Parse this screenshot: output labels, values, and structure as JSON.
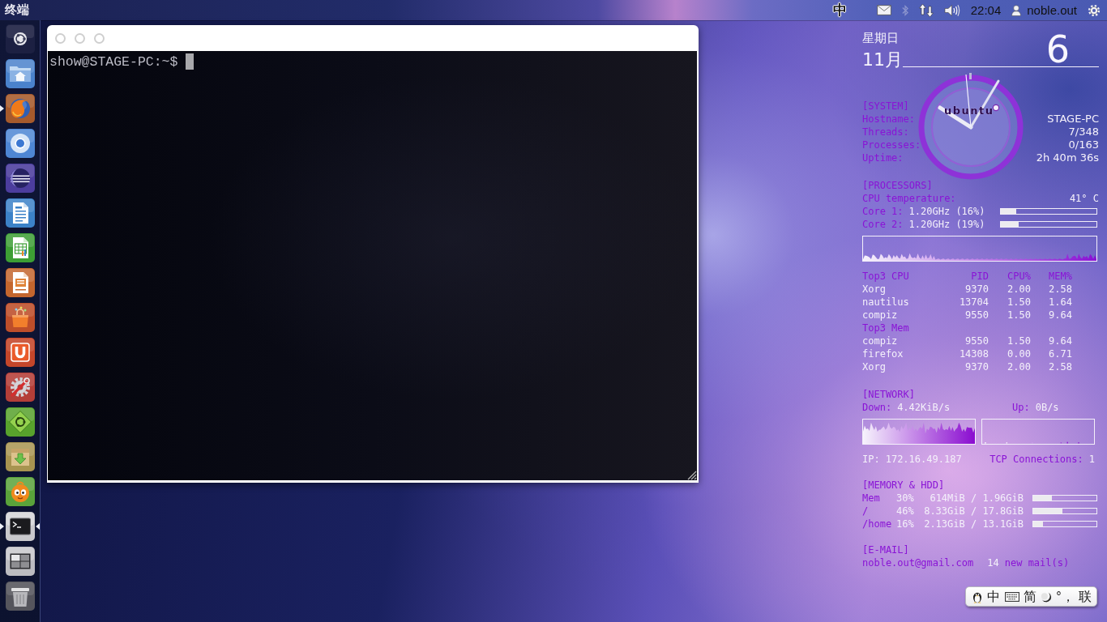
{
  "top_panel": {
    "app_title": "终端",
    "input_method": "中",
    "bluetooth_enabled": false,
    "clock": "22:04",
    "user": "noble.out"
  },
  "launcher": [
    {
      "running": false,
      "focused": false
    },
    {
      "running": false,
      "focused": false
    },
    {
      "running": true,
      "focused": false
    },
    {
      "running": false,
      "focused": false
    },
    {
      "running": false,
      "focused": false
    },
    {
      "running": false,
      "focused": false
    },
    {
      "running": false,
      "focused": false
    },
    {
      "running": false,
      "focused": false
    },
    {
      "running": false,
      "focused": false
    },
    {
      "running": false,
      "focused": false
    },
    {
      "running": false,
      "focused": false
    },
    {
      "running": false,
      "focused": false
    },
    {
      "running": false,
      "focused": false
    },
    {
      "running": false,
      "focused": false
    },
    {
      "running": true,
      "focused": true
    },
    {
      "running": false,
      "focused": false
    },
    {
      "running": false,
      "focused": false
    }
  ],
  "terminal": {
    "prompt": "show@STAGE-PC:~$"
  },
  "conky": {
    "weekday": "星期日",
    "month": "11月",
    "day": "6",
    "clock_logo": "ubuntu",
    "system": {
      "heading": "[SYSTEM]",
      "rows": [
        {
          "label": "Hostname:",
          "value": "STAGE-PC"
        },
        {
          "label": "Threads:",
          "value": "7/348"
        },
        {
          "label": "Processes:",
          "value": "0/163"
        },
        {
          "label": "Uptime:",
          "value": "2h 40m 36s"
        }
      ]
    },
    "processors": {
      "heading": "[PROCESSORS]",
      "temperature": {
        "label": "CPU temperature:",
        "value": "41° C"
      },
      "cores": [
        {
          "label": "Core 1:",
          "value": "1.20GHz (16%)",
          "level": 0.16
        },
        {
          "label": "Core 2:",
          "value": "1.20GHz (19%)",
          "level": 0.19
        }
      ]
    },
    "top_processes": {
      "columns": [
        "Top3 CPU",
        "PID",
        "CPU%",
        "MEM%"
      ],
      "cpu_rows": [
        {
          "name": "Xorg",
          "pid": "9370",
          "cpu": "2.00",
          "mem": "2.58"
        },
        {
          "name": "nautilus",
          "pid": "13704",
          "cpu": "1.50",
          "mem": "1.64"
        },
        {
          "name": "compiz",
          "pid": "9550",
          "cpu": "1.50",
          "mem": "9.64"
        }
      ],
      "mem_title": "Top3 Mem",
      "mem_rows": [
        {
          "name": "compiz",
          "pid": "9550",
          "cpu": "1.50",
          "mem": "9.64"
        },
        {
          "name": "firefox",
          "pid": "14308",
          "cpu": "0.00",
          "mem": "6.71"
        },
        {
          "name": "Xorg",
          "pid": "9370",
          "cpu": "2.00",
          "mem": "2.58"
        }
      ]
    },
    "network": {
      "heading": "[NETWORK]",
      "down_label": "Down:",
      "down_value": "4.42KiB/s",
      "up_label": "Up:",
      "up_value": "0B/s",
      "ip_label": "IP:",
      "ip_value": "172.16.49.187",
      "tcp_label": "TCP Connections:",
      "tcp_value": "1"
    },
    "memory": {
      "heading": "[MEMORY & HDD]",
      "rows": [
        {
          "label": "Mem",
          "percent": "30%",
          "usage": "614MiB / 1.96GiB",
          "level": 0.3
        },
        {
          "label": "/",
          "percent": "46%",
          "usage": "8.33GiB / 17.8GiB",
          "level": 0.46
        },
        {
          "label": "/home",
          "percent": "16%",
          "usage": "2.13GiB / 13.1GiB",
          "level": 0.16
        }
      ]
    },
    "email": {
      "heading": "[E-MAIL]",
      "address": "noble.out@gmail.com",
      "count": "14",
      "count_label": "new mail(s)"
    }
  },
  "ime_toolbar": {
    "mode": "中",
    "script": "简",
    "punctuation": "°，",
    "network": "联"
  }
}
